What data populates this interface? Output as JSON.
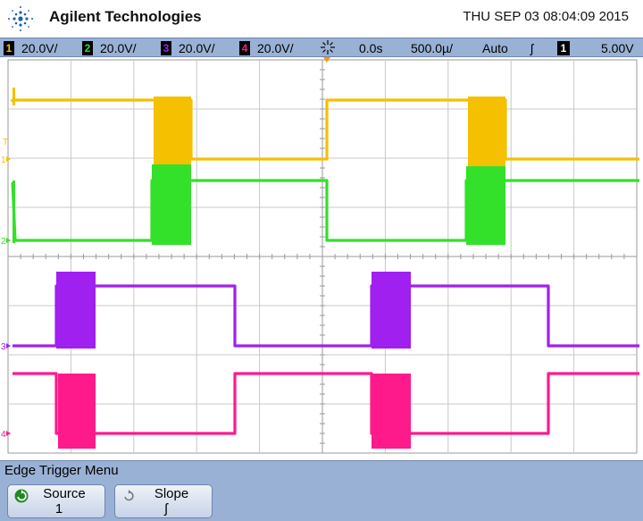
{
  "header": {
    "brand": "Agilent Technologies",
    "datetime": "THU SEP 03 08:04:09 2015",
    "logo_icon": "agilent-spark-icon"
  },
  "status_bar": {
    "channels": [
      {
        "num": "1",
        "scale": "20.0V/",
        "color": "#f5c000"
      },
      {
        "num": "2",
        "scale": "20.0V/",
        "color": "#33e02a"
      },
      {
        "num": "3",
        "scale": "20.0V/",
        "color": "#a020f0"
      },
      {
        "num": "4",
        "scale": "20.0V/",
        "color": "#ff1a8c"
      }
    ],
    "run_icon": "acquisition-spark-icon",
    "delay": "0.0s",
    "timebase": "500.0µ/",
    "trigger_mode": "Auto",
    "trigger_slope_symbol": "ʃ",
    "trigger_source": "1",
    "trigger_level": "5.00V"
  },
  "markers": {
    "trigger_level": "T",
    "ch1": "1",
    "ch2": "2",
    "ch3": "3",
    "ch4": "4"
  },
  "menu": {
    "title": "Edge Trigger Menu",
    "softkeys": [
      {
        "label": "Source",
        "value": "1",
        "icon": "cycle-arrow-icon"
      },
      {
        "label": "Slope",
        "value": "ʃ",
        "icon": "cycle-arrow-icon"
      }
    ]
  },
  "colors": {
    "ch1": "#f5c000",
    "ch2": "#33e02a",
    "ch3": "#a020f0",
    "ch4": "#ff1a8c",
    "status_bg": "#9ab1d6"
  }
}
